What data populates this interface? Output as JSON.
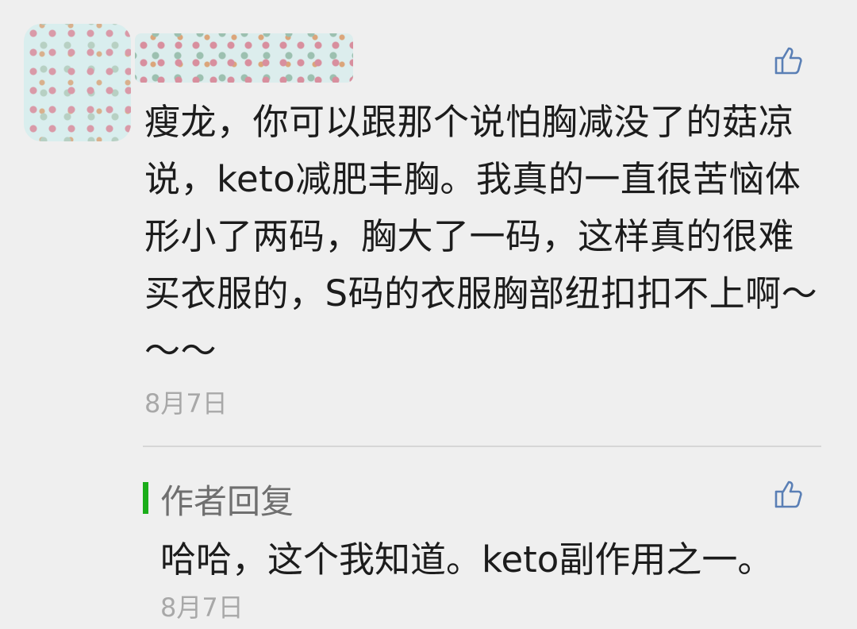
{
  "comment": {
    "text": "瘦龙，你可以跟那个说怕胸减没了的菇凉说，keto减肥丰胸。我真的一直很苦恼体形小了两码，胸大了一码，这样真的很难买衣服的，S码的衣服胸部纽扣扣不上啊～～～",
    "date": "8月7日"
  },
  "reply": {
    "label": "作者回复",
    "text": "哈哈，这个我知道。keto副作用之一。",
    "date": "8月7日"
  },
  "colors": {
    "reply_accent": "#1aad19",
    "like_icon": "#5a7fb5"
  },
  "icons": {
    "like": "thumbs-up-icon"
  }
}
